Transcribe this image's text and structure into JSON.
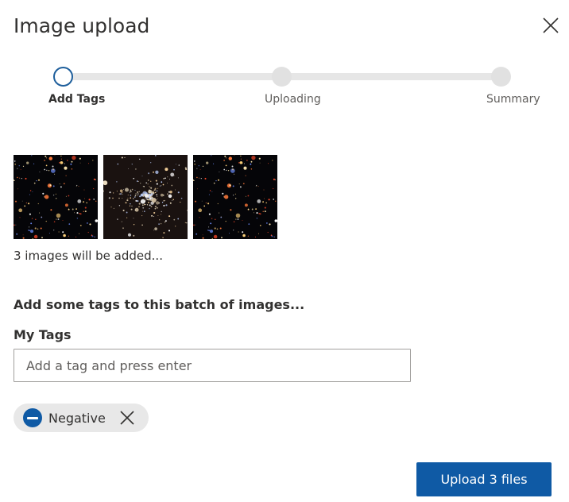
{
  "dialog": {
    "title": "Image upload",
    "close_icon": "close-icon"
  },
  "stepper": {
    "steps": [
      {
        "label": "Add Tags",
        "state": "current"
      },
      {
        "label": "Uploading",
        "state": "pending"
      },
      {
        "label": "Summary",
        "state": "pending"
      }
    ]
  },
  "images": {
    "count_text": "3 images will be added...",
    "items": [
      "starfield-image",
      "globular-cluster-image",
      "starfield-image"
    ]
  },
  "tags": {
    "heading": "Add some tags to this batch of images...",
    "field_label": "My Tags",
    "input_placeholder": "Add a tag and press enter",
    "input_value": "",
    "chips": [
      {
        "label": "Negative",
        "icon": "minus-circle-icon",
        "remove_icon": "close-icon"
      }
    ]
  },
  "actions": {
    "upload_label": "Upload 3 files"
  },
  "colors": {
    "accent": "#0f5aa5",
    "step_current_border": "#1f5f9c",
    "track": "#e6e6e6",
    "chip_bg": "#e8e8e8"
  }
}
